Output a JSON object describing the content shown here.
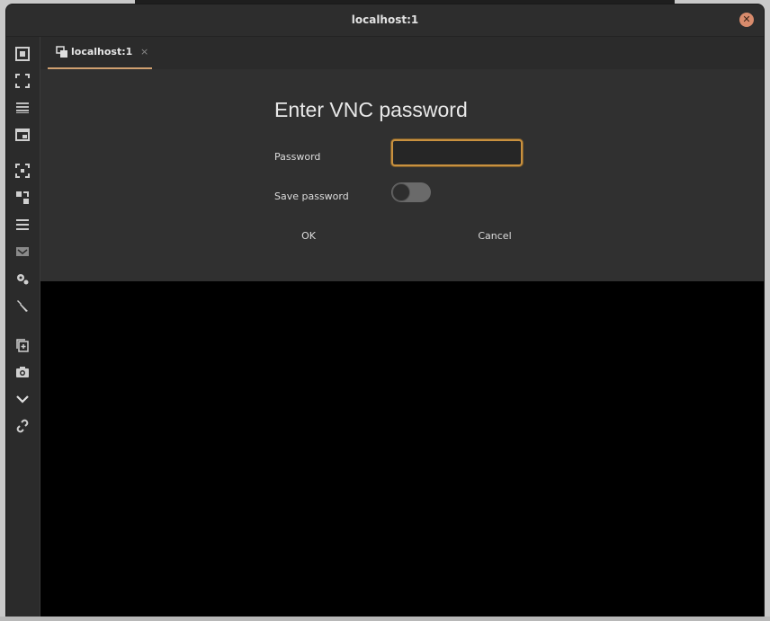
{
  "window": {
    "title": "localhost:1",
    "close_icon": "close-icon"
  },
  "toolbar": {
    "items": [
      {
        "name": "scale-icon"
      },
      {
        "name": "fullscreen-icon"
      },
      {
        "name": "menu-icon"
      },
      {
        "name": "window-icon"
      },
      {
        "name": "resize-icon"
      },
      {
        "name": "dynamic-resolution-icon"
      },
      {
        "name": "list-icon"
      },
      {
        "name": "keyboard-icon"
      },
      {
        "name": "preferences-icon"
      },
      {
        "name": "tools-icon"
      },
      {
        "name": "duplicate-icon"
      },
      {
        "name": "screenshot-icon"
      },
      {
        "name": "chevron-down-icon"
      },
      {
        "name": "disconnect-icon"
      }
    ]
  },
  "tab": {
    "label": "localhost:1",
    "close": "×",
    "icon": "remote-desktop-icon"
  },
  "dialog": {
    "heading": "Enter VNC password",
    "password_label": "Password",
    "password_value": "",
    "save_label": "Save password",
    "save_enabled": false,
    "ok_label": "OK",
    "cancel_label": "Cancel"
  },
  "colors": {
    "accent": "#c9913f",
    "window_bg": "#2b2b2b",
    "panel_bg": "#303030",
    "viewer_bg": "#000000"
  }
}
